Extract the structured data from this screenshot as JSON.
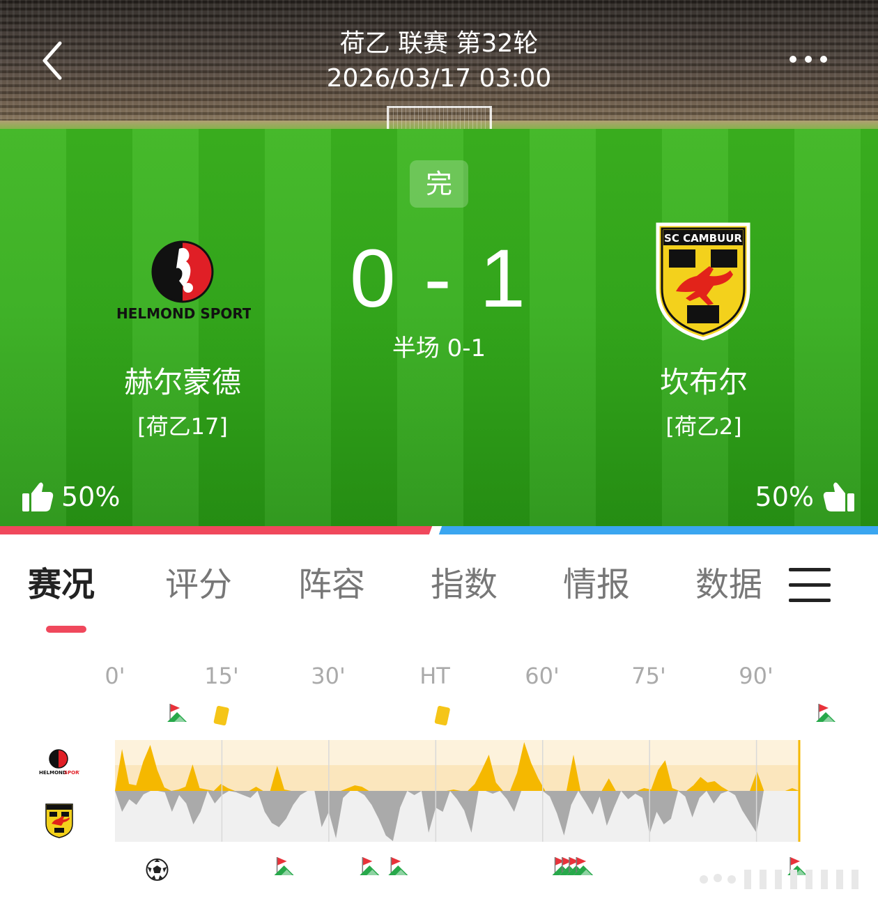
{
  "header": {
    "competition": "荷乙 联赛 第32轮",
    "datetime": "2026/03/17 03:00",
    "status": "完"
  },
  "match": {
    "score": "0 - 1",
    "halftime": "半场 0-1",
    "home": {
      "name": "赫尔蒙德",
      "rank": "[荷乙17]",
      "logo_text": "HELMOND SPORT",
      "vote": "50%"
    },
    "away": {
      "name": "坎布尔",
      "rank": "[荷乙2]",
      "logo_text": "SC CAMBUUR",
      "vote": "50%"
    },
    "vote_share": {
      "home": 0.5,
      "away": 0.5
    }
  },
  "tabs": [
    "赛况",
    "评分",
    "阵容",
    "指数",
    "情报",
    "数据"
  ],
  "active_tab": "赛况",
  "timeline": {
    "labels": [
      "0'",
      "15'",
      "30'",
      "HT",
      "60'",
      "75'",
      "90'"
    ],
    "home_events": [
      {
        "type": "corner-icon",
        "minute": 5
      },
      {
        "type": "yellow-card-icon",
        "minute": 11
      },
      {
        "type": "yellow-card-icon",
        "minute": 42
      },
      {
        "type": "corner-icon",
        "minute": 96
      }
    ],
    "away_events": [
      {
        "type": "goal-icon",
        "minute": 2
      },
      {
        "type": "corner-icon",
        "minute": 20
      },
      {
        "type": "corner-icon",
        "minute": 32
      },
      {
        "type": "corner-icon",
        "minute": 36
      },
      {
        "type": "corner-icon",
        "minute": 59
      },
      {
        "type": "corner-icon",
        "minute": 60
      },
      {
        "type": "corner-icon",
        "minute": 61
      },
      {
        "type": "corner-icon",
        "minute": 62
      },
      {
        "type": "corner-icon",
        "minute": 92
      }
    ]
  },
  "colors": {
    "accent": "#f0485c",
    "away_bar": "#3aa6f0",
    "home_pressure": "#f5b800",
    "away_pressure": "#aaaaaa"
  }
}
